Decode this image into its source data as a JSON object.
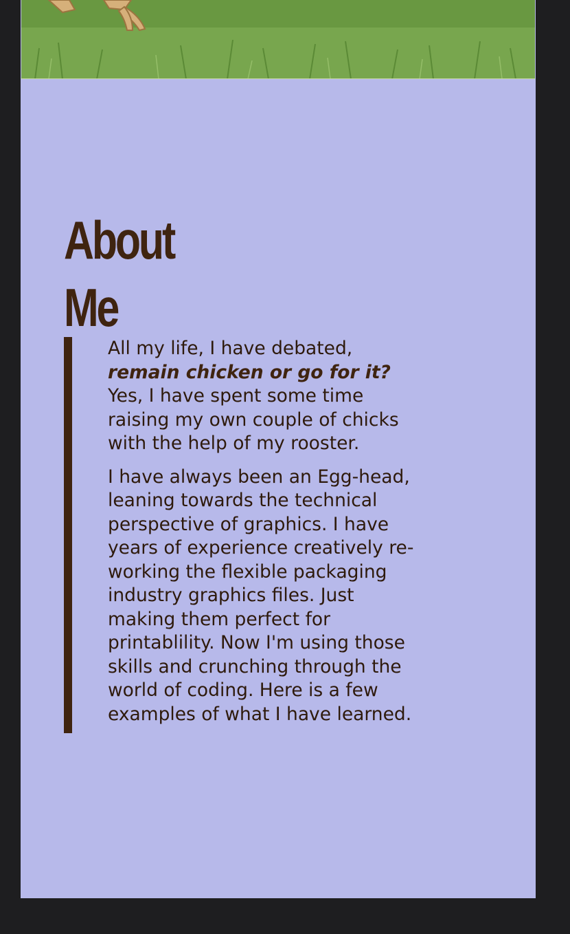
{
  "hero": {
    "image_name": "chicken-feet-on-grass-photo"
  },
  "about": {
    "title_line1": "About",
    "title_line2": "Me",
    "paragraph1_intro": "All my life, I have debated,",
    "paragraph1_emphasis": "remain chicken or go for it?",
    "paragraph1_rest": "Yes, I have spent some time raising my own couple of chicks with the help of my rooster.",
    "paragraph2": "I have always been an Egg-head, leaning towards the technical perspective of graphics. I have years of experience creatively re-working the flexible packaging industry graphics files. Just making them perfect for printablility. Now I'm using those skills and crunching through the world of coding. Here is a few examples of what I have learned."
  },
  "colors": {
    "page_background": "#b7b9ea",
    "outer_background": "#1e1e20",
    "heading_brown": "#3f2410",
    "text_brown": "#2e1a0c",
    "grass_green": "#6f9d45"
  }
}
